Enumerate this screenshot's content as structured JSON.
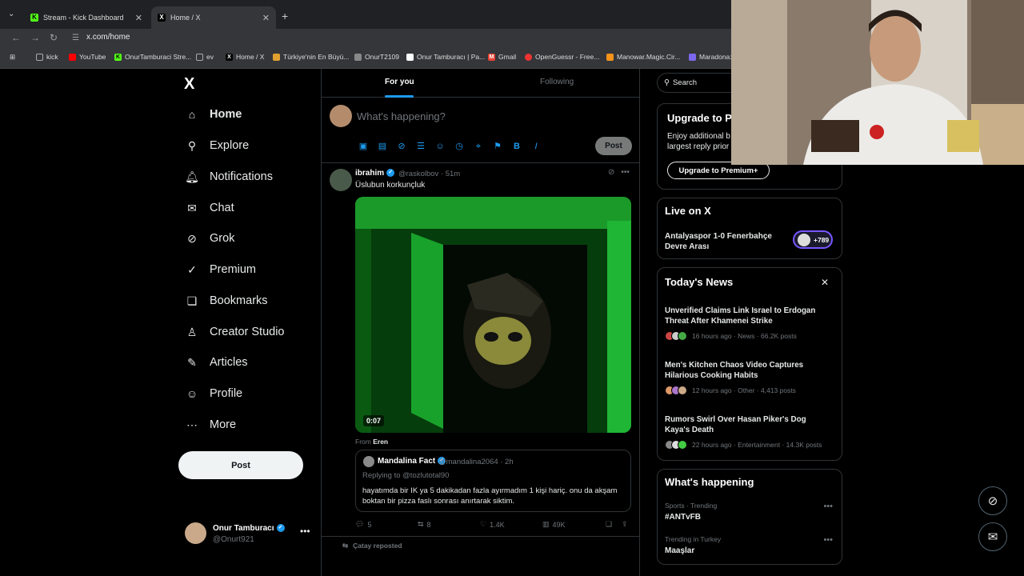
{
  "browser": {
    "tabs": [
      {
        "title": "Stream - Kick Dashboard",
        "fav_color": "#53fc18",
        "fav_char": "K"
      },
      {
        "title": "Home / X",
        "fav_color": "#000000",
        "fav_char": "X"
      }
    ],
    "url": "x.com/home",
    "bookmarks": [
      {
        "label": "kick",
        "color": "#aaaaaa",
        "ch": ""
      },
      {
        "label": "YouTube",
        "color": "#ff0000",
        "ch": ""
      },
      {
        "label": "OnurTamburaci Stre...",
        "color": "#53fc18",
        "ch": "K"
      },
      {
        "label": "ev",
        "color": "#aaaaaa",
        "ch": ""
      },
      {
        "label": "Home / X",
        "color": "#000000",
        "ch": "X"
      },
      {
        "label": "Türkiye'nin En Büyü...",
        "color": "#e0a030",
        "ch": ""
      },
      {
        "label": "OnurT2109",
        "color": "#888888",
        "ch": ""
      },
      {
        "label": "Onur Tamburacı | Pa...",
        "color": "#ffffff",
        "ch": ""
      },
      {
        "label": "Gmail",
        "color": "#ea4335",
        "ch": "M"
      },
      {
        "label": "OpenGuessr - Free...",
        "color": "#e33",
        "ch": ""
      },
      {
        "label": "Manowar.Magic.Cir...",
        "color": "#f7931a",
        "ch": ""
      },
      {
        "label": "Maradona:",
        "color": "#7b68ee",
        "ch": ""
      }
    ]
  },
  "nav": {
    "logo": "X",
    "items": [
      {
        "label": "Home",
        "icon": "⌂"
      },
      {
        "label": "Explore",
        "icon": "⚲"
      },
      {
        "label": "Notifications",
        "icon": "♫"
      },
      {
        "label": "Chat",
        "icon": "✉"
      },
      {
        "label": "Grok",
        "icon": "⊘"
      },
      {
        "label": "Premium",
        "icon": "✓"
      },
      {
        "label": "Bookmarks",
        "icon": "❏"
      },
      {
        "label": "Creator Studio",
        "icon": "♙"
      },
      {
        "label": "Articles",
        "icon": "✎"
      },
      {
        "label": "Profile",
        "icon": "☺"
      },
      {
        "label": "More",
        "icon": "⋯"
      }
    ],
    "post_label": "Post",
    "account": {
      "name": "Onur Tamburacı",
      "handle": "@Onurt921"
    }
  },
  "feed": {
    "tab_for_you": "For you",
    "tab_following": "Following",
    "compose_placeholder": "What's happening?",
    "compose_post": "Post",
    "tweet": {
      "name": "ibrahim",
      "handle": "@raskolbov · 51m",
      "text": "Üslubun korkunçluk",
      "duration": "0:07",
      "from_prefix": "From",
      "from_name": "Eren",
      "quote": {
        "name": "Mandalina Fact",
        "handle": "@mandalina2064 · 2h",
        "replying": "Replying to @tozlutotal90",
        "text": "hayatımda bir IK ya 5 dakikadan fazla ayırmadım 1 kişi hariç. onu da akşam boktan bir pizza faslı sonrası anırtarak siktim."
      },
      "replies": "5",
      "reposts": "8",
      "likes": "1.4K",
      "views": "49K"
    },
    "next_reposted": "Çatay reposted"
  },
  "right": {
    "search_placeholder": "Search",
    "upgrade": {
      "title": "Upgrade to P",
      "sub1": "Enjoy additional b",
      "sub2": "largest reply prior",
      "button": "Upgrade to Premium+"
    },
    "live": {
      "title": "Live on X",
      "line1": "Antalyaspor 1-0 Fenerbahçe",
      "line2": "Devre Arası",
      "count": "+789"
    },
    "news_title": "Today's News",
    "news": [
      {
        "headline": "Unverified Claims Link Israel to Erdogan Threat After Khamenei Strike",
        "meta": "16 hours ago · News · 66.2K posts"
      },
      {
        "headline": "Men's Kitchen Chaos Video Captures Hilarious Cooking Habits",
        "meta": "12 hours ago · Other · 4,413 posts"
      },
      {
        "headline": "Rumors Swirl Over Hasan Piker's Dog Kaya's Death",
        "meta": "22 hours ago · Entertainment · 14.3K posts"
      }
    ],
    "happening_title": "What's happening",
    "trends": [
      {
        "context": "Sports · Trending",
        "topic": "#ANTvFB"
      },
      {
        "context": "Trending in Turkey",
        "topic": "Maaşlar"
      }
    ]
  },
  "colors": {
    "accent": "#1d9bf0",
    "bg": "#000000",
    "border": "#2f3336",
    "muted": "#71767b"
  }
}
